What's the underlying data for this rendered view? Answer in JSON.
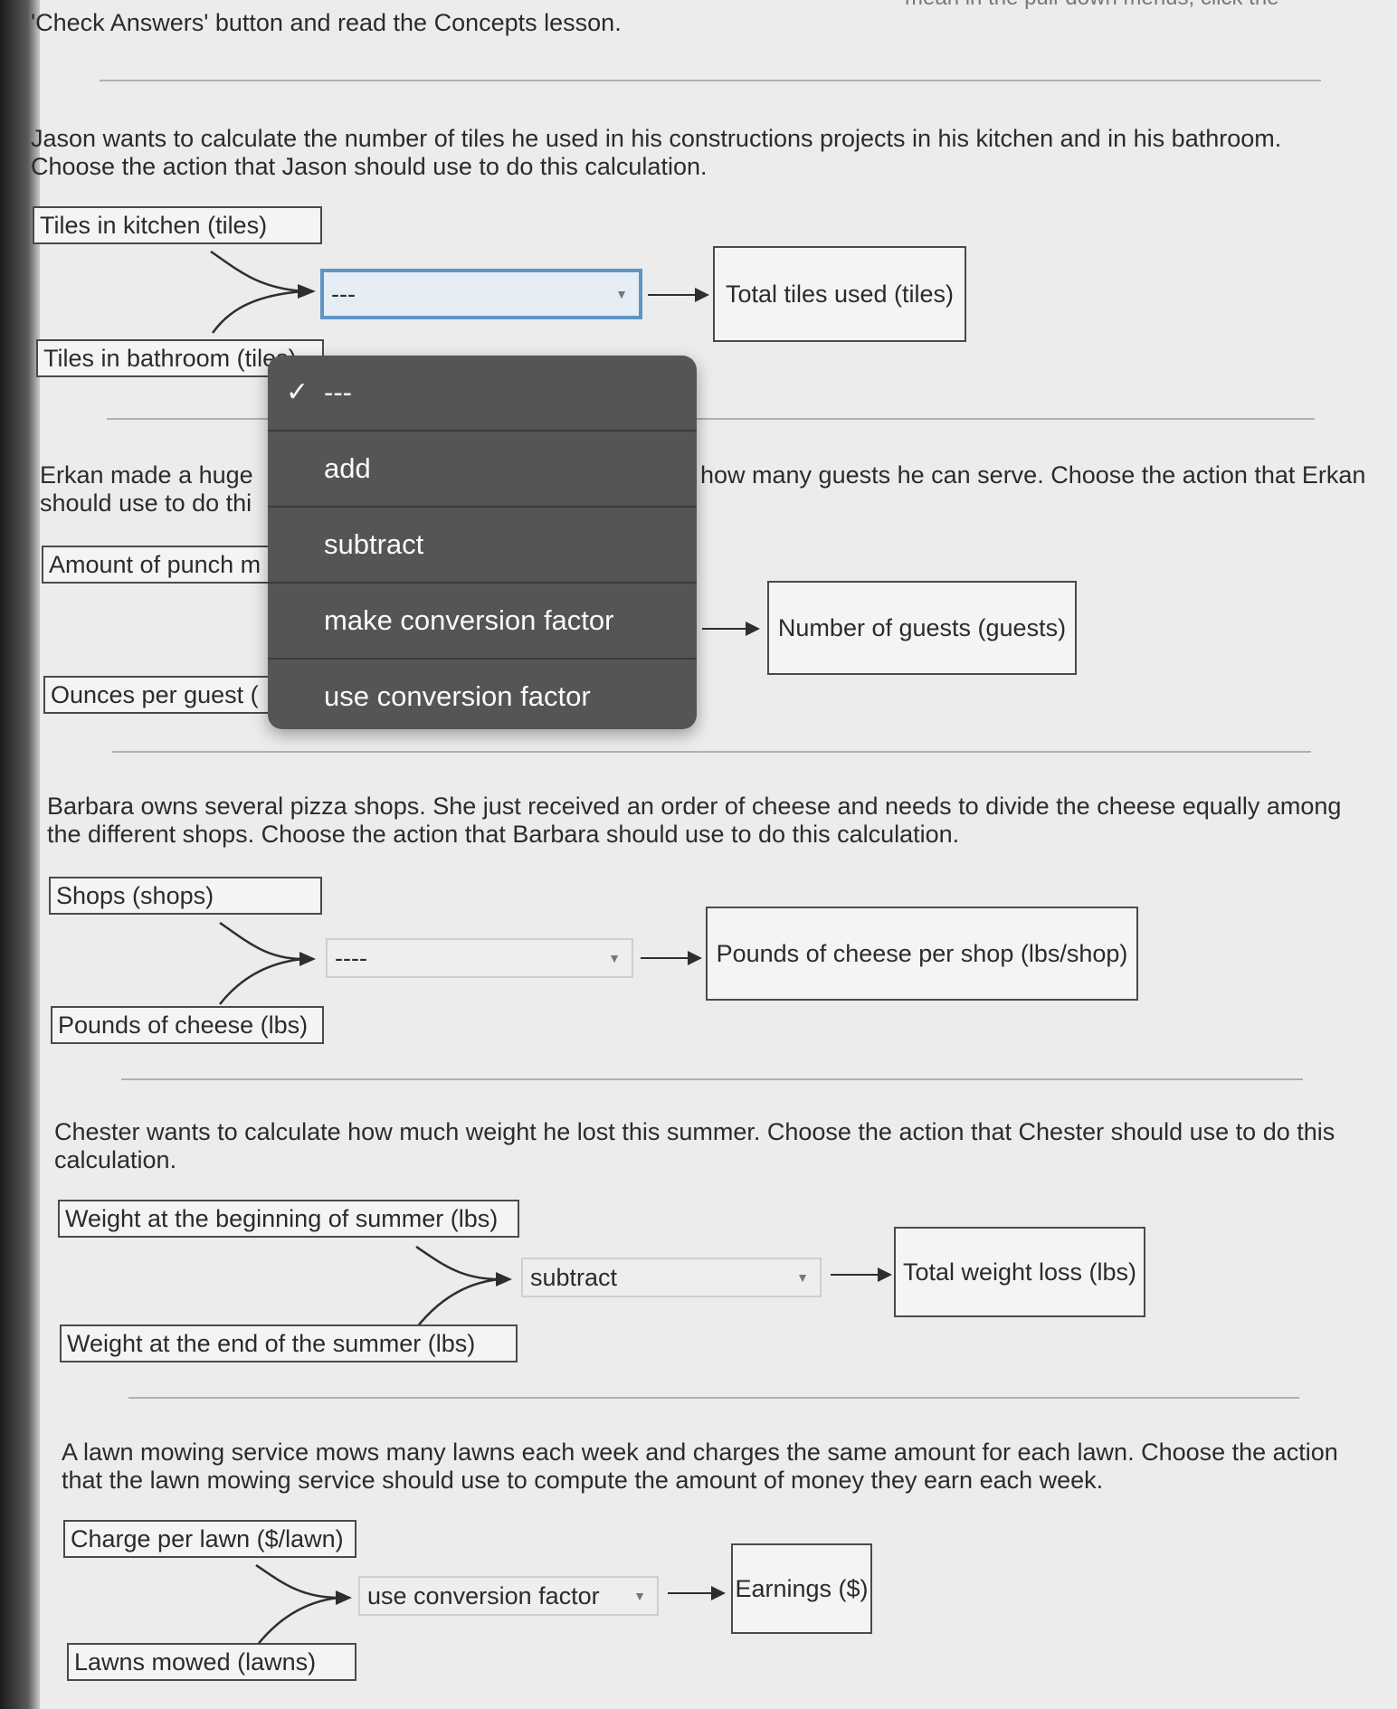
{
  "instructions": {
    "top_partial": "mean in the pull-down menus, click the",
    "line": "'Check Answers' button and read the Concepts lesson."
  },
  "problems": [
    {
      "question": "Jason wants to calculate the number of tiles he used in his constructions projects in his kitchen and in his bathroom. Choose the action that Jason should use to do this calculation.",
      "input1": "Tiles in kitchen (tiles)",
      "input2": "Tiles in bathroom (tiles)",
      "select_value": "---",
      "output": "Total tiles used (tiles)"
    },
    {
      "question_start": "Erkan made a huge",
      "question_end": "how many guests he can serve. Choose the action that Erkan",
      "question_line2": "should use to do thi",
      "input1": "Amount of punch m",
      "input2": "Ounces per guest (",
      "output": "Number of guests (guests)"
    },
    {
      "question": "Barbara owns several pizza shops. She just received an order of cheese and needs to divide the cheese equally among the different shops. Choose the action that Barbara should use to do this calculation.",
      "input1": "Shops (shops)",
      "input2": "Pounds of cheese (lbs)",
      "select_value": "----",
      "output": "Pounds of cheese per shop (lbs/shop)"
    },
    {
      "question": "Chester wants to calculate how much weight he lost this summer. Choose the action that Chester should use to do this calculation.",
      "input1": "Weight at the beginning of summer (lbs)",
      "input2": "Weight at the end of the summer (lbs)",
      "select_value": "subtract",
      "output": "Total weight loss (lbs)"
    },
    {
      "question": "A lawn mowing service mows many lawns each week and charges the same amount for each lawn. Choose the action that the lawn mowing service should use to compute the amount of money they earn each week.",
      "input1": "Charge per lawn ($/lawn)",
      "input2": "Lawns mowed (lawns)",
      "select_value": "use conversion factor",
      "output": "Earnings ($)"
    }
  ],
  "dropdown": {
    "options": [
      "---",
      "add",
      "subtract",
      "make conversion factor",
      "use conversion factor"
    ],
    "selected": "---"
  },
  "colors": {
    "focus_border": "#5d95c7",
    "menu_bg": "#555555",
    "menu_text": "#fafafa"
  }
}
